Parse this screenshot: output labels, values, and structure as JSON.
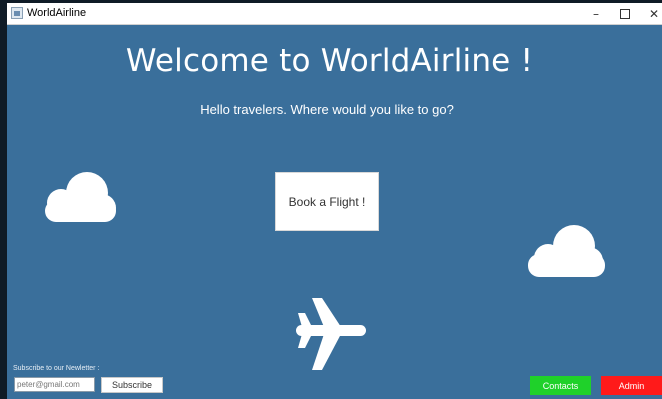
{
  "window": {
    "title": "WorldAirline",
    "controls": {
      "minimize": "–",
      "close": "✕"
    }
  },
  "main": {
    "heading": "Welcome to WorldAirline !",
    "subheading": "Hello travelers. Where would you like to go?",
    "book_button": "Book a Flight !"
  },
  "newsletter": {
    "label": "Subscribe to our Newletter :",
    "email_value": "peter@gmail.com",
    "subscribe_button": "Subscribe"
  },
  "footer": {
    "contacts_button": "Contacts",
    "admin_button": "Admin"
  },
  "icons": {
    "app": "app-window-icon",
    "clouds": "cloud-icon",
    "plane": "airplane-icon"
  },
  "colors": {
    "background": "#3a6f9b",
    "contacts": "#1fd12a",
    "admin": "#ff1a1a"
  }
}
